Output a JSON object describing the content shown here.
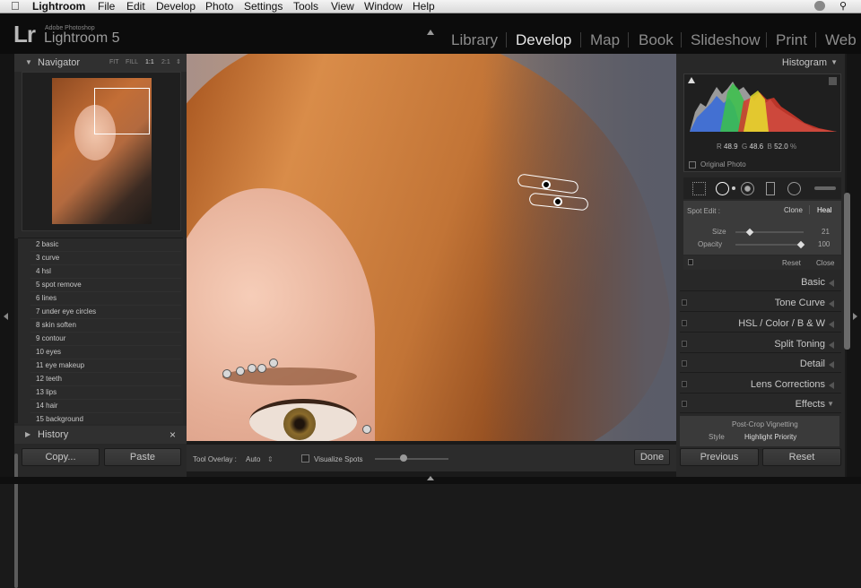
{
  "menubar": {
    "app": "Lightroom",
    "items": [
      "File",
      "Edit",
      "Develop",
      "Photo",
      "Settings",
      "Tools",
      "View",
      "Window",
      "Help"
    ]
  },
  "identity": {
    "logo": "Lr",
    "vendor": "Adobe Photoshop",
    "product": "Lightroom 5"
  },
  "modules": [
    "Library",
    "Develop",
    "Map",
    "Book",
    "Slideshow",
    "Print",
    "Web"
  ],
  "active_module": "Develop",
  "navigator": {
    "title": "Navigator",
    "zoom_options": [
      "FIT",
      "FILL",
      "1:1",
      "2:1"
    ]
  },
  "presets": [
    "2 basic",
    "3 curve",
    "4 hsl",
    "5 spot remove",
    "6 lines",
    "7 under eye circles",
    "8 skin soften",
    "9 contour",
    "10 eyes",
    "11 eye makeup",
    "12 teeth",
    "13 lips",
    "14 hair",
    "15 background"
  ],
  "history": {
    "title": "History",
    "close": "×"
  },
  "left_buttons": {
    "copy": "Copy...",
    "paste": "Paste"
  },
  "histogram": {
    "title": "Histogram",
    "r_label": "R",
    "r": "48.9",
    "g_label": "G",
    "g": "48.6",
    "b_label": "B",
    "b": "52.0",
    "unit": "%",
    "original": "Original Photo"
  },
  "spot_edit": {
    "label": "Spot Edit :",
    "modes": [
      "Clone",
      "Heal"
    ],
    "active_mode": "Heal",
    "size_label": "Size",
    "size": "21",
    "size_fraction": 0.21,
    "opacity_label": "Opacity",
    "opacity": "100",
    "opacity_fraction": 1.0,
    "reset": "Reset",
    "close": "Close"
  },
  "sections": [
    {
      "label": "Basic"
    },
    {
      "label": "Tone Curve"
    },
    {
      "label": "HSL  /  Color  /  B & W"
    },
    {
      "label": "Split Toning"
    },
    {
      "label": "Detail"
    },
    {
      "label": "Lens Corrections"
    },
    {
      "label": "Effects"
    }
  ],
  "effects": {
    "vignette_title": "Post-Crop Vignetting",
    "style_label": "Style",
    "style_value": "Highlight Priority"
  },
  "right_buttons": {
    "previous": "Previous",
    "reset": "Reset"
  },
  "toolbar": {
    "overlay_label": "Tool Overlay :",
    "overlay_value": "Auto",
    "visualize": "Visualize Spots",
    "done": "Done"
  }
}
